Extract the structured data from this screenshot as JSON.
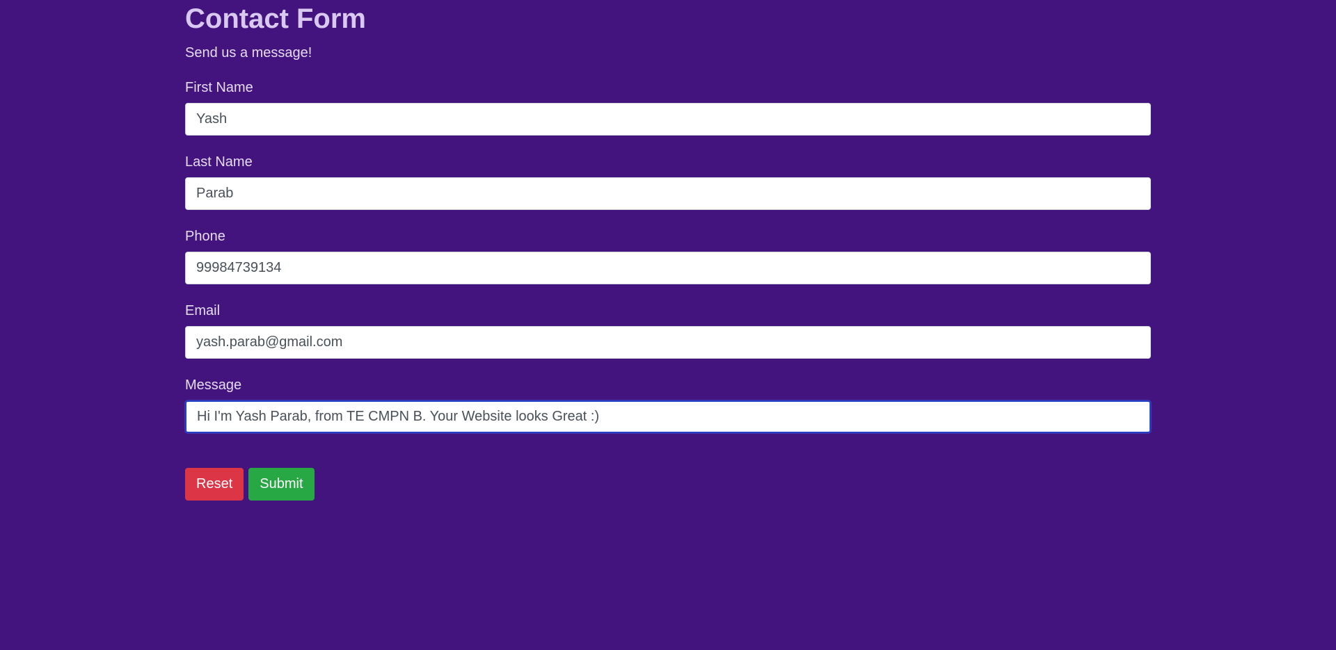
{
  "form": {
    "title": "Contact Form",
    "subtitle": "Send us a message!",
    "fields": [
      {
        "label": "First Name",
        "value": "Yash"
      },
      {
        "label": "Last Name",
        "value": "Parab"
      },
      {
        "label": "Phone",
        "value": "99984739134"
      },
      {
        "label": "Email",
        "value": "yash.parab@gmail.com"
      },
      {
        "label": "Message",
        "value": "Hi I'm Yash Parab, from TE CMPN B. Your Website looks Great :)"
      }
    ],
    "buttons": {
      "reset_label": "Reset",
      "submit_label": "Submit"
    }
  },
  "colors": {
    "background": "#43137e",
    "reset": "#dc3545",
    "submit": "#28a745",
    "focus_border": "#1f3fc8"
  }
}
